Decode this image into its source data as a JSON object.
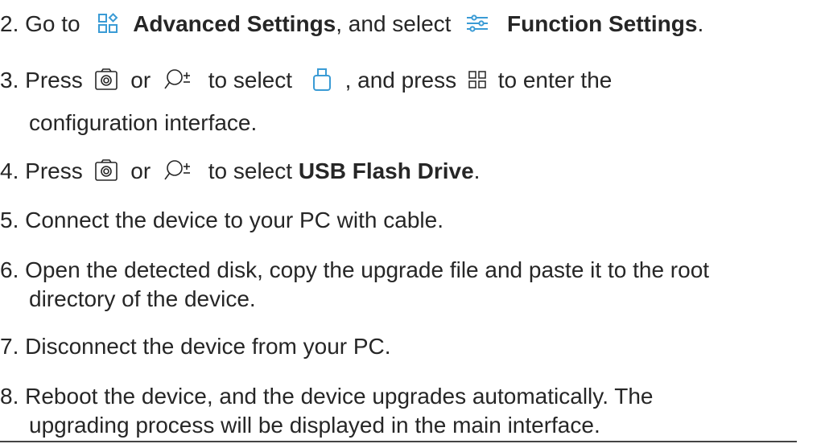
{
  "steps": [
    {
      "number": "2.",
      "parts": [
        "Go to",
        "Advanced Settings",
        ", and select",
        "Function Settings",
        "."
      ],
      "icons": [
        "advanced-settings-icon",
        "function-settings-icon"
      ]
    },
    {
      "number": "3.",
      "parts": [
        "Press",
        "or",
        "to select",
        ", and press",
        "to enter the"
      ],
      "continuation": "configuration interface.",
      "icons": [
        "camera-icon",
        "zoom-icon",
        "usb-icon",
        "menu-grid-icon"
      ]
    },
    {
      "number": "4.",
      "parts": [
        "Press",
        "or",
        "to select",
        "USB Flash Drive",
        "."
      ],
      "icons": [
        "camera-icon",
        "zoom-icon"
      ]
    },
    {
      "number": "5.",
      "parts": [
        "Connect the device to your PC with cable."
      ]
    },
    {
      "number": "6.",
      "parts": [
        "Open the detected disk, copy the upgrade file and paste it to the root"
      ],
      "continuation": "directory of the device."
    },
    {
      "number": "7.",
      "parts": [
        "Disconnect the device from your PC."
      ]
    },
    {
      "number": "8.",
      "parts": [
        "Reboot the device, and the device upgrades automatically. The"
      ],
      "continuation": "upgrading process will be displayed in the main interface."
    }
  ],
  "colors": {
    "text": "#262626",
    "accent": "#3a9bd5"
  }
}
